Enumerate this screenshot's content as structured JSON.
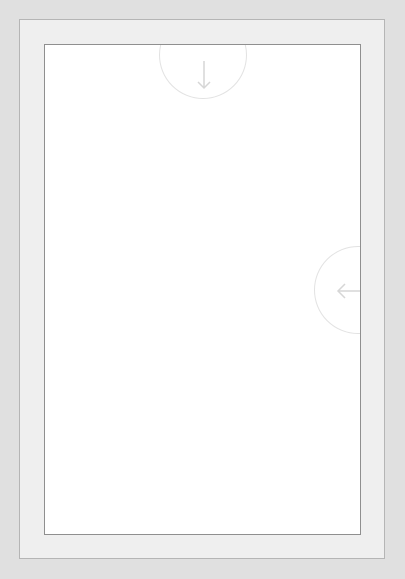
{
  "viewer": {
    "controls": {
      "next_page_icon": "arrow-down-icon",
      "next_spread_icon": "arrow-left-icon"
    },
    "colors": {
      "background": "#e0e0e0",
      "frame": "#efefef",
      "page": "#ffffff",
      "page_border": "#8f8f8f",
      "control_stroke": "#d6d6d6"
    }
  }
}
